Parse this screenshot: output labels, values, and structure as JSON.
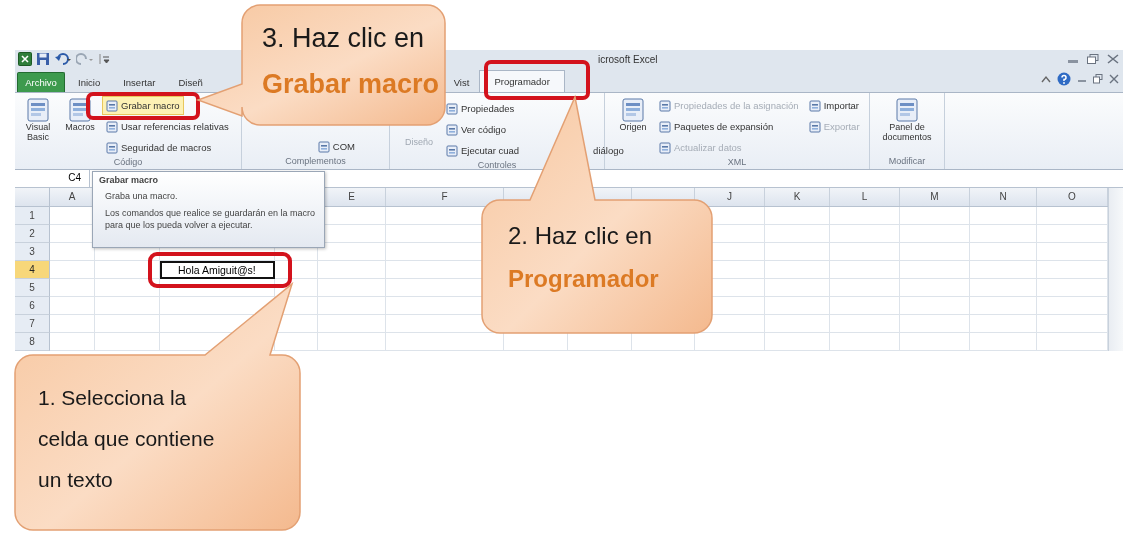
{
  "title_bar": {
    "title": "icrosoft Excel"
  },
  "tabs": [
    {
      "label": "Archivo",
      "kind": "file",
      "selected": false
    },
    {
      "label": "Inicio",
      "kind": "tab",
      "selected": false
    },
    {
      "label": "Insertar",
      "kind": "tab",
      "selected": false
    },
    {
      "label": "Diseñ",
      "kind": "tab",
      "selected": false
    },
    {
      "label": "Vist",
      "kind": "tab",
      "selected": false
    },
    {
      "label": "Programador",
      "kind": "tab",
      "selected": true
    }
  ],
  "ribbon": {
    "groups": [
      {
        "label": "Código",
        "kind": "code",
        "columns": [
          {
            "kind": "large",
            "items": [
              {
                "label": "Visual Basic",
                "disabled": false
              }
            ]
          },
          {
            "kind": "large",
            "items": [
              {
                "label": "Macros",
                "disabled": false
              }
            ]
          },
          {
            "kind": "small",
            "items": [
              {
                "label": "Grabar macro",
                "disabled": false,
                "highlighted": true
              },
              {
                "label": "Usar referencias relativas",
                "disabled": false,
                "highlighted": false
              },
              {
                "label": "Seguridad de macros",
                "disabled": false,
                "highlighted": false
              }
            ]
          }
        ]
      },
      {
        "label": "Complementos",
        "kind": "addins",
        "columns": [
          {
            "kind": "small",
            "items": [
              {
                "label": "COM",
                "disabled": false,
                "highlighted": false
              }
            ]
          }
        ]
      },
      {
        "label": "Controles",
        "kind": "controls",
        "columns": [
          {
            "kind": "large",
            "items": [
              {
                "label": "Diseño",
                "disabled": true
              }
            ]
          },
          {
            "kind": "small",
            "items": [
              {
                "label": "Propiedades",
                "disabled": false,
                "highlighted": false
              },
              {
                "label": "Ver código",
                "disabled": false,
                "highlighted": false
              },
              {
                "label": "Ejecutar cuad",
                "continuation": "diálogo",
                "disabled": false,
                "highlighted": false
              }
            ]
          }
        ]
      },
      {
        "label": "XML",
        "kind": "xml",
        "columns": [
          {
            "kind": "large",
            "items": [
              {
                "label": "Origen",
                "disabled": false
              }
            ]
          },
          {
            "kind": "small",
            "items": [
              {
                "label": "Propiedades de la asignación",
                "disabled": true,
                "highlighted": false
              },
              {
                "label": "Paquetes de expansión",
                "disabled": false,
                "highlighted": false
              },
              {
                "label": "Actualizar datos",
                "disabled": true,
                "highlighted": false
              }
            ]
          },
          {
            "kind": "small",
            "items": [
              {
                "label": "Importar",
                "disabled": false,
                "highlighted": false
              },
              {
                "label": "Exportar",
                "disabled": true,
                "highlighted": false
              }
            ]
          }
        ]
      },
      {
        "label": "Modificar",
        "kind": "modify",
        "columns": [
          {
            "kind": "large",
            "items": [
              {
                "label": "Panel de documentos",
                "disabled": false
              }
            ]
          }
        ]
      }
    ]
  },
  "formula_bar": {
    "name_box": "C4"
  },
  "tooltip": {
    "title": "Grabar macro",
    "lines": [
      "Graba una macro.",
      "Los comandos que realice se guardarán en la macro para que los pueda volver a ejecutar."
    ]
  },
  "sheet": {
    "column_groups": [
      [
        "A"
      ],
      [
        "E",
        "F"
      ],
      [
        "J",
        "K",
        "L",
        "M",
        "N",
        "O"
      ]
    ],
    "rows": [
      {
        "label": "1",
        "selected": false
      },
      {
        "label": "2",
        "selected": false
      },
      {
        "label": "3",
        "selected": false
      },
      {
        "label": "4",
        "selected": true,
        "text": "Hola Amiguit@s!"
      },
      {
        "label": "5",
        "selected": false
      },
      {
        "label": "6",
        "selected": false
      },
      {
        "label": "7",
        "selected": false
      },
      {
        "label": "8",
        "selected": false
      }
    ]
  },
  "callouts": [
    {
      "text": "3. Haz clic en",
      "highlight": "Grabar macro"
    },
    {
      "text": "2. Haz clic en",
      "highlight": "Programador"
    },
    {
      "text": "1. Selecciona la celda que contiene un texto"
    }
  ]
}
